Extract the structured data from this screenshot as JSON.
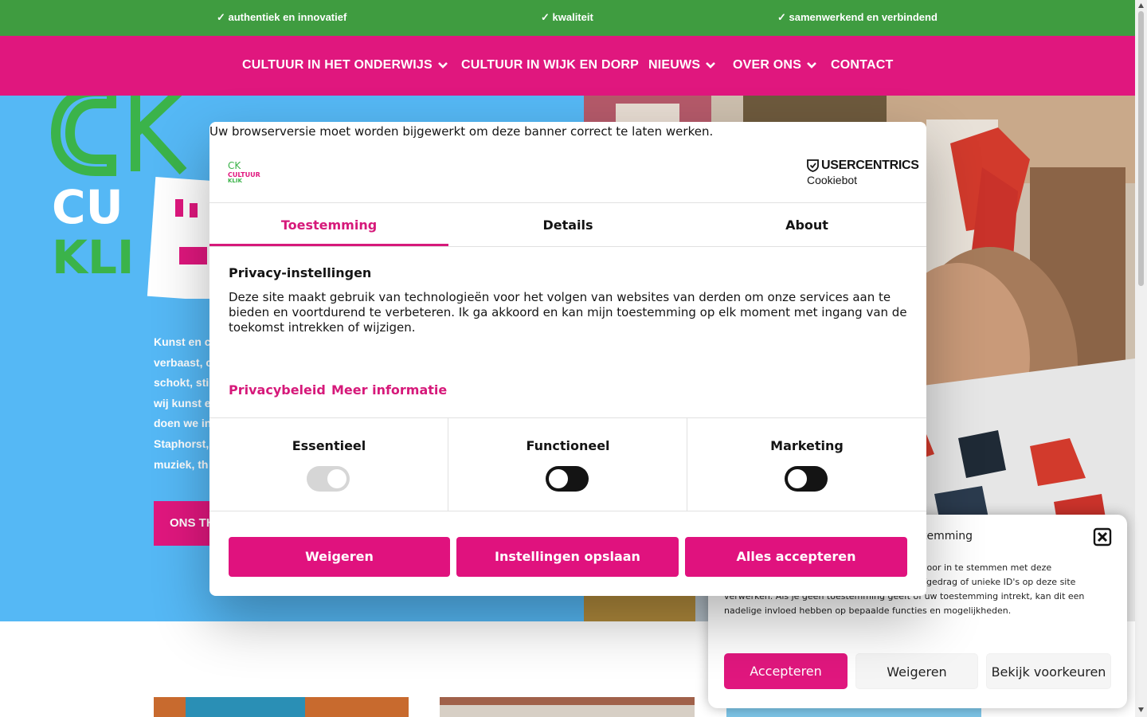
{
  "topbar": {
    "items": [
      "✓ authentiek en innovatief",
      "✓ kwaliteit",
      "✓ samenwerkend en verbindend"
    ]
  },
  "nav": {
    "items": [
      {
        "label": "CULTUUR IN HET ONDERWIJS",
        "has_dropdown": true
      },
      {
        "label": "CULTUUR IN WIJK EN DORP",
        "has_dropdown": false
      },
      {
        "label": "NIEUWS",
        "has_dropdown": true
      },
      {
        "label": "OVER ONS",
        "has_dropdown": true
      },
      {
        "label": "CONTACT",
        "has_dropdown": false
      }
    ]
  },
  "hero": {
    "logo_text": [
      "CK",
      "CU",
      "KLI"
    ],
    "text_lines": [
      "Kunst en c",
      "verbaast, c",
      "schokt, stir",
      "wij kunst e",
      "doen we in",
      "Staphorst,",
      "muziek, th"
    ],
    "button_label": "ONS TH"
  },
  "cookiebot": {
    "warning": "Uw browserversie moet worden bijgewerkt om deze banner correct te laten werken.",
    "logo_text": [
      "CK",
      "CULTUUR",
      "KLIK"
    ],
    "brand_name": "USERCENTRICS",
    "brand_sub": "Cookiebot",
    "tabs": [
      "Toestemming",
      "Details",
      "About"
    ],
    "heading": "Privacy-instellingen",
    "body": "Deze site maakt gebruik van technologieën voor het volgen van websites van derden om onze services aan te bieden en voortdurend te verbeteren. Ik ga akkoord en kan mijn toestemming op elk moment met ingang van de toekomst intrekken of wijzigen.",
    "links": [
      "Privacybeleid",
      "Meer informatie"
    ],
    "categories": [
      {
        "label": "Essentieel",
        "state": "on-disabled"
      },
      {
        "label": "Functioneel",
        "state": "off"
      },
      {
        "label": "Marketing",
        "state": "off"
      }
    ],
    "buttons": [
      "Weigeren",
      "Instellingen opslaan",
      "Alles accepteren"
    ],
    "accent": "#e0127e"
  },
  "cmplz": {
    "title": "temming",
    "text": "technologieën zoals cookies om informatie                                                          . Door in te stemmen met deze technologieën kunnen wij gegevens zoals surfgedrag of unieke ID's op deze site verwerken. Als je geen toestemming geeft of uw toestemming intrekt, kan dit een nadelige invloed hebben op bepaalde functies en mogelijkheden.",
    "buttons": [
      "Accepteren",
      "Weigeren",
      "Bekijk voorkeuren"
    ]
  },
  "colors": {
    "green": "#3f9c40",
    "pink": "#e0177e",
    "sky": "#55b8f5"
  }
}
